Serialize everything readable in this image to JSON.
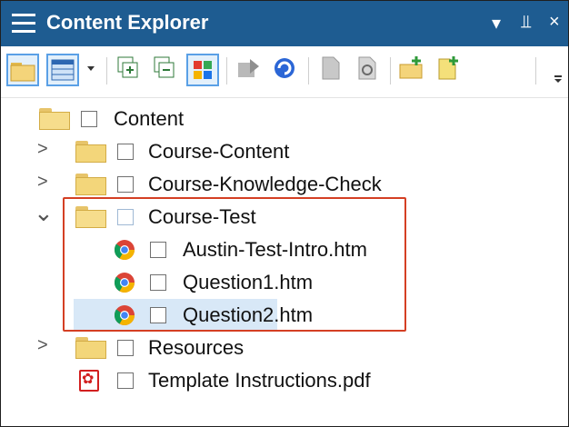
{
  "window": {
    "title": "Content Explorer",
    "controls": {
      "dropdown": "▾",
      "pin": "⫫",
      "close": "×"
    }
  },
  "toolbar": {
    "buttons": [
      {
        "name": "open-folder-button",
        "icon": "folder-icon",
        "selected": true
      },
      {
        "name": "view-mode-button",
        "icon": "grid-view-icon",
        "selected": true
      },
      {
        "name": "view-dropdown-button",
        "icon": "chevron-down-icon",
        "selected": false
      },
      {
        "name": "expand-all-button",
        "icon": "expand-icon",
        "selected": false
      },
      {
        "name": "collapse-all-button",
        "icon": "collapse-icon",
        "selected": false
      },
      {
        "name": "color-grid-button",
        "icon": "color-grid-icon",
        "selected": true
      },
      {
        "name": "move-button",
        "icon": "move-icon",
        "selected": false
      },
      {
        "name": "refresh-button",
        "icon": "refresh-icon",
        "selected": false
      },
      {
        "name": "document-button",
        "icon": "document-icon",
        "selected": false
      },
      {
        "name": "properties-button",
        "icon": "properties-icon",
        "selected": false
      },
      {
        "name": "new-folder-button",
        "icon": "new-folder-icon",
        "selected": false
      },
      {
        "name": "new-file-button",
        "icon": "new-file-icon",
        "selected": false
      }
    ]
  },
  "tree": {
    "items": [
      {
        "label": "Content",
        "icon": "folder-open-icon",
        "expander": ""
      },
      {
        "label": "Course-Content",
        "icon": "folder-icon",
        "expander": ">"
      },
      {
        "label": "Course-Knowledge-Check",
        "icon": "folder-icon",
        "expander": ">"
      },
      {
        "label": "Course-Test",
        "icon": "folder-open-icon",
        "expander": "⌄",
        "selected": true
      },
      {
        "label": "Austin-Test-Intro.htm",
        "icon": "chrome-icon",
        "expander": ""
      },
      {
        "label": "Question1.htm",
        "icon": "chrome-icon",
        "expander": ""
      },
      {
        "label": "Question2.htm",
        "icon": "chrome-icon",
        "expander": ""
      },
      {
        "label": "Resources",
        "icon": "folder-icon",
        "expander": ">"
      },
      {
        "label": "Template Instructions.pdf",
        "icon": "pdf-icon",
        "expander": ""
      }
    ]
  },
  "colors": {
    "titlebar": "#1e5c91",
    "selection": "#d8e8f7",
    "highlight_box": "#d43f24"
  }
}
